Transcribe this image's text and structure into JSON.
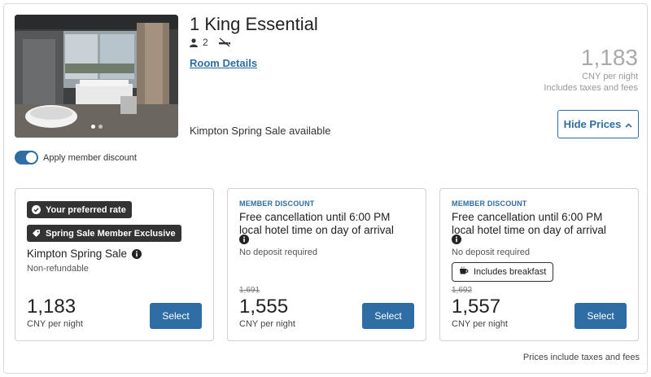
{
  "room": {
    "title": "1 King Essential",
    "guests": "2",
    "details_link": "Room Details",
    "sale_available": "Kimpton Spring Sale available",
    "photo_icon": "room-photo"
  },
  "top_price": {
    "amount": "1,183",
    "unit": "CNY per night",
    "taxes": "Includes taxes and fees"
  },
  "hide_prices_label": "Hide Prices",
  "member_toggle": {
    "label": "Apply member discount",
    "checked": true
  },
  "rates": [
    {
      "badges": [
        "Your preferred rate",
        "Spring Sale Member Exclusive"
      ],
      "name": "Kimpton Spring Sale",
      "sub": "Non-refundable",
      "price": "1,183",
      "unit": "CNY per night",
      "select": "Select"
    },
    {
      "tag": "MEMBER DISCOUNT",
      "name": "Free cancellation until 6:00 PM local hotel time on day of arrival",
      "sub": "No deposit required",
      "original_price": "1,691",
      "price": "1,555",
      "unit": "CNY per night",
      "select": "Select"
    },
    {
      "tag": "MEMBER DISCOUNT",
      "name": "Free cancellation until 6:00 PM local hotel time on day of arrival",
      "sub": "No deposit required",
      "chip": "Includes breakfast",
      "original_price": "1,692",
      "price": "1,557",
      "unit": "CNY per night",
      "select": "Select"
    }
  ],
  "footer": "Prices include taxes and fees",
  "colors": {
    "accent": "#2e6da4",
    "badge": "#333333"
  }
}
